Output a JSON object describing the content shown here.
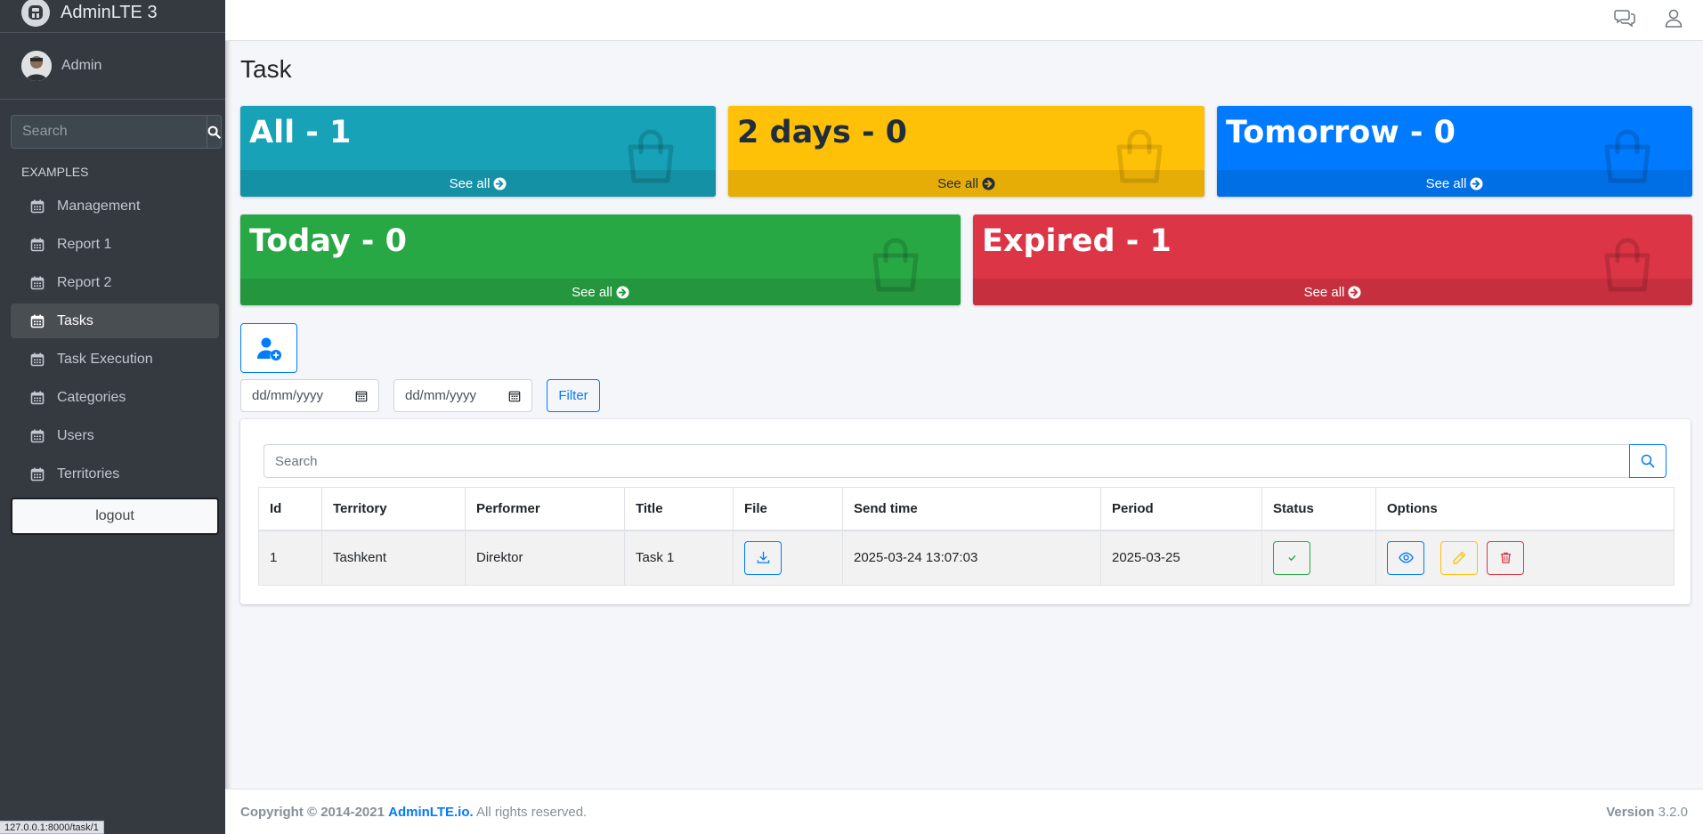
{
  "brand": {
    "text": "AdminLTE 3"
  },
  "user": {
    "name": "Admin"
  },
  "sidebar": {
    "search_placeholder": "Search",
    "header": "EXAMPLES",
    "items": [
      {
        "label": "Management"
      },
      {
        "label": "Report 1"
      },
      {
        "label": "Report 2"
      },
      {
        "label": "Tasks"
      },
      {
        "label": "Task Execution"
      },
      {
        "label": "Categories"
      },
      {
        "label": "Users"
      },
      {
        "label": "Territories"
      }
    ],
    "logout": "logout"
  },
  "status_url": "127.0.0.1:8000/task/1",
  "page": {
    "title": "Task"
  },
  "boxes": [
    {
      "value": "All - 1",
      "link": "See all",
      "color": "#17a2b8"
    },
    {
      "value": "2 days - 0",
      "link": "See all",
      "color": "#ffc107"
    },
    {
      "value": "Tomorrow - 0",
      "link": "See all",
      "color": "#007bff"
    },
    {
      "value": "Today - 0",
      "link": "See all",
      "color": "#28a745"
    },
    {
      "value": "Expired - 1",
      "link": "See all",
      "color": "#dc3545"
    }
  ],
  "filters": {
    "date_from": "dd/mm/yyyy",
    "date_to": "dd/mm/yyyy",
    "filter_label": "Filter"
  },
  "table": {
    "search_placeholder": "Search",
    "headers": [
      "Id",
      "Territory",
      "Performer",
      "Title",
      "File",
      "Send time",
      "Period",
      "Status",
      "Options"
    ],
    "rows": [
      {
        "id": "1",
        "territory": "Tashkent",
        "performer": "Direktor",
        "title": "Task 1",
        "send_time": "2025-03-24 13:07:03",
        "period": "2025-03-25"
      }
    ]
  },
  "footer": {
    "copyright": "Copyright © 2014-2021",
    "link": "AdminLTE.io.",
    "rights": "All rights reserved.",
    "version_label": "Version",
    "version": "3.2.0"
  },
  "icons": {
    "brand": "adminlte-logo-icon",
    "search": "search-icon",
    "calendar": "calendar-icon",
    "bag": "shopping-bag-icon",
    "arrow": "arrow-circle-right-icon",
    "add_user": "user-plus-icon",
    "download": "download-icon",
    "check": "check-icon",
    "view": "eye-icon",
    "edit": "pencil-icon",
    "delete": "trash-icon",
    "chat": "comments-icon",
    "profile": "user-icon"
  }
}
